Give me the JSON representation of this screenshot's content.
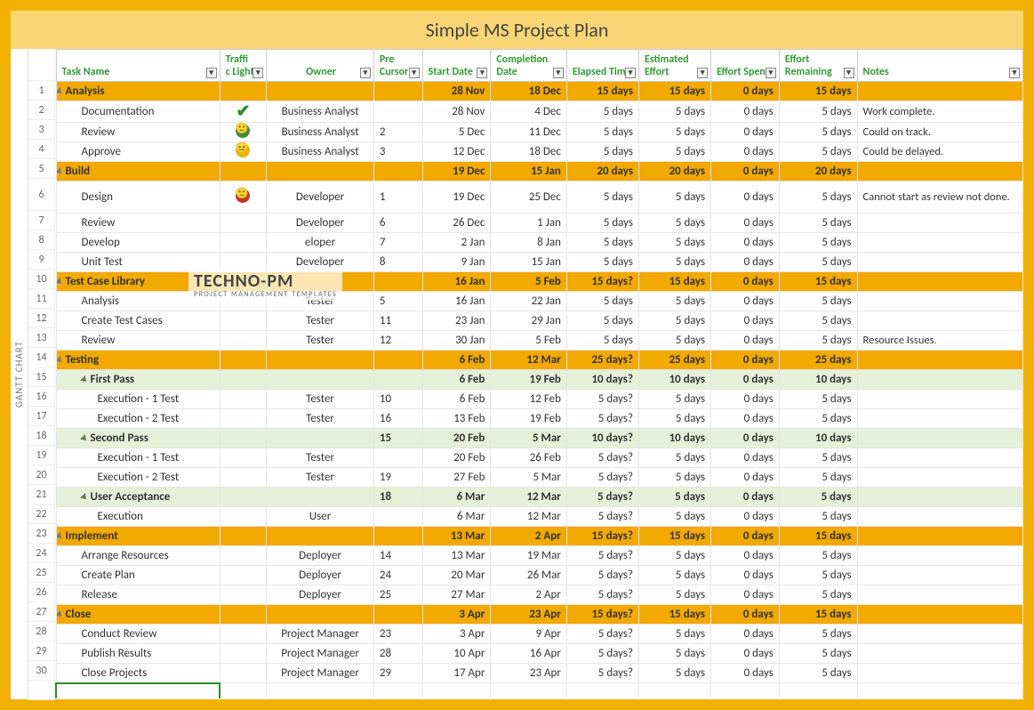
{
  "title": "Simple MS Project Plan",
  "side_label": "GANTT CHART",
  "watermark": {
    "brand": "TECHNO-PM",
    "logo_char": "✔",
    "sub": "PROJECT MANAGEMENT TEMPLATES"
  },
  "headers": {
    "task": "Task Name",
    "traffic": "Traffi\nc Light",
    "owner": "Owner",
    "pre": "Pre Cursor",
    "start": "Start Date",
    "completion": "Completion Date",
    "elapsed": "Elapsed Time",
    "estimated": "Estimated Effort",
    "spent": "Effort Spent",
    "remaining": "Effort Remaining",
    "notes": "Notes"
  },
  "rows": [
    {
      "n": 1,
      "type": "section",
      "indent": 1,
      "task": "Analysis",
      "tl": "",
      "owner": "",
      "pre": "",
      "start": "28 Nov",
      "end": "18 Dec",
      "elapsed": "15 days",
      "est": "15 days",
      "spent": "0 days",
      "rem": "15 days",
      "notes": ""
    },
    {
      "n": 2,
      "type": "task",
      "indent": 2,
      "task": "Documentation",
      "tl": "check",
      "owner": "Business Analyst",
      "pre": "",
      "start": "28 Nov",
      "end": "4 Dec",
      "elapsed": "5 days",
      "est": "5 days",
      "spent": "0 days",
      "rem": "5 days",
      "notes": "Work complete."
    },
    {
      "n": 3,
      "type": "task",
      "indent": 2,
      "task": "Review",
      "tl": "green",
      "owner": "Business Analyst",
      "pre": "2",
      "start": "5 Dec",
      "end": "11 Dec",
      "elapsed": "5 days",
      "est": "5 days",
      "spent": "0 days",
      "rem": "5 days",
      "notes": "Could on track."
    },
    {
      "n": 4,
      "type": "task",
      "indent": 2,
      "task": "Approve",
      "tl": "yellow",
      "owner": "Business Analyst",
      "pre": "3",
      "start": "12 Dec",
      "end": "18 Dec",
      "elapsed": "5 days",
      "est": "5 days",
      "spent": "0 days",
      "rem": "5 days",
      "notes": "Could be delayed."
    },
    {
      "n": 5,
      "type": "section",
      "indent": 1,
      "task": "Build",
      "tl": "",
      "owner": "",
      "pre": "",
      "start": "19 Dec",
      "end": "15 Jan",
      "elapsed": "20 days",
      "est": "20 days",
      "spent": "0 days",
      "rem": "20 days",
      "notes": ""
    },
    {
      "n": 6,
      "type": "task",
      "indent": 2,
      "tall": true,
      "task": "Design",
      "tl": "red",
      "owner": "Developer",
      "pre": "1",
      "start": "19 Dec",
      "end": "25 Dec",
      "elapsed": "5 days",
      "est": "5 days",
      "spent": "0 days",
      "rem": "5 days",
      "notes": "Cannot start as review not done."
    },
    {
      "n": 7,
      "type": "task",
      "indent": 2,
      "task": "Review",
      "tl": "",
      "owner": "Developer",
      "pre": "6",
      "start": "26 Dec",
      "end": "1 Jan",
      "elapsed": "5 days",
      "est": "5 days",
      "spent": "0 days",
      "rem": "5 days",
      "notes": ""
    },
    {
      "n": 8,
      "type": "task",
      "indent": 2,
      "task": "Develop",
      "tl": "",
      "owner": "eloper",
      "pre": "7",
      "start": "2 Jan",
      "end": "8 Jan",
      "elapsed": "5 days",
      "est": "5 days",
      "spent": "0 days",
      "rem": "5 days",
      "notes": ""
    },
    {
      "n": 9,
      "type": "task",
      "indent": 2,
      "task": "Unit Test",
      "tl": "",
      "owner": "Developer",
      "pre": "8",
      "start": "9 Jan",
      "end": "15 Jan",
      "elapsed": "5 days",
      "est": "5 days",
      "spent": "0 days",
      "rem": "5 days",
      "notes": ""
    },
    {
      "n": 10,
      "type": "section",
      "indent": 1,
      "task": "Test Case Library",
      "tl": "",
      "owner": "",
      "pre": "",
      "start": "16 Jan",
      "end": "5 Feb",
      "elapsed": "15 days?",
      "est": "15 days",
      "spent": "0 days",
      "rem": "15 days",
      "notes": ""
    },
    {
      "n": 11,
      "type": "task",
      "indent": 2,
      "task": "Analysis",
      "tl": "",
      "owner": "Tester",
      "pre": "5",
      "start": "16 Jan",
      "end": "22 Jan",
      "elapsed": "5 days",
      "est": "5 days",
      "spent": "0 days",
      "rem": "5 days",
      "notes": ""
    },
    {
      "n": 12,
      "type": "task",
      "indent": 2,
      "task": "Create Test Cases",
      "tl": "",
      "owner": "Tester",
      "pre": "11",
      "start": "23 Jan",
      "end": "29 Jan",
      "elapsed": "5 days",
      "est": "5 days",
      "spent": "0 days",
      "rem": "5 days",
      "notes": ""
    },
    {
      "n": 13,
      "type": "task",
      "indent": 2,
      "task": "Review",
      "tl": "",
      "owner": "Tester",
      "pre": "12",
      "start": "30 Jan",
      "end": "5 Feb",
      "elapsed": "5 days",
      "est": "5 days",
      "spent": "0 days",
      "rem": "5 days",
      "notes": "Resource Issues."
    },
    {
      "n": 14,
      "type": "section",
      "indent": 1,
      "task": "Testing",
      "tl": "",
      "owner": "",
      "pre": "",
      "start": "6 Feb",
      "end": "12 Mar",
      "elapsed": "25 days?",
      "est": "25 days",
      "spent": "0 days",
      "rem": "25 days",
      "notes": ""
    },
    {
      "n": 15,
      "type": "sub",
      "indent": 2,
      "task": "First Pass",
      "tl": "",
      "owner": "",
      "pre": "",
      "start": "6 Feb",
      "end": "19 Feb",
      "elapsed": "10 days?",
      "est": "10 days",
      "spent": "0 days",
      "rem": "10 days",
      "notes": ""
    },
    {
      "n": 16,
      "type": "task",
      "indent": 3,
      "task": "Execution - 1 Test",
      "tl": "",
      "owner": "Tester",
      "pre": "10",
      "start": "6 Feb",
      "end": "12 Feb",
      "elapsed": "5 days?",
      "est": "5 days",
      "spent": "0 days",
      "rem": "5 days",
      "notes": ""
    },
    {
      "n": 17,
      "type": "task",
      "indent": 3,
      "task": "Execution - 2 Test",
      "tl": "",
      "owner": "Tester",
      "pre": "16",
      "start": "13 Feb",
      "end": "19 Feb",
      "elapsed": "5 days?",
      "est": "5 days",
      "spent": "0 days",
      "rem": "5 days",
      "notes": ""
    },
    {
      "n": 18,
      "type": "sub",
      "indent": 2,
      "task": "Second Pass",
      "tl": "",
      "owner": "",
      "pre": "15",
      "start": "20 Feb",
      "end": "5 Mar",
      "elapsed": "10 days?",
      "est": "10 days",
      "spent": "0 days",
      "rem": "10 days",
      "notes": ""
    },
    {
      "n": 19,
      "type": "task",
      "indent": 3,
      "task": "Execution - 1 Test",
      "tl": "",
      "owner": "Tester",
      "pre": "",
      "start": "20 Feb",
      "end": "26 Feb",
      "elapsed": "5 days?",
      "est": "5 days",
      "spent": "0 days",
      "rem": "5 days",
      "notes": ""
    },
    {
      "n": 20,
      "type": "task",
      "indent": 3,
      "task": "Execution - 2 Test",
      "tl": "",
      "owner": "Tester",
      "pre": "19",
      "start": "27 Feb",
      "end": "5 Mar",
      "elapsed": "5 days?",
      "est": "5 days",
      "spent": "0 days",
      "rem": "5 days",
      "notes": ""
    },
    {
      "n": 21,
      "type": "sub",
      "indent": 2,
      "task": "User Acceptance",
      "tl": "",
      "owner": "",
      "pre": "18",
      "start": "6 Mar",
      "end": "12 Mar",
      "elapsed": "5 days?",
      "est": "5 days",
      "spent": "0 days",
      "rem": "5 days",
      "notes": ""
    },
    {
      "n": 22,
      "type": "task",
      "indent": 3,
      "task": "Execution",
      "tl": "",
      "owner": "User",
      "pre": "",
      "start": "6 Mar",
      "end": "12 Mar",
      "elapsed": "5 days?",
      "est": "5 days",
      "spent": "0 days",
      "rem": "5 days",
      "notes": ""
    },
    {
      "n": 23,
      "type": "section",
      "indent": 1,
      "task": "Implement",
      "tl": "",
      "owner": "",
      "pre": "",
      "start": "13 Mar",
      "end": "2 Apr",
      "elapsed": "15 days?",
      "est": "15 days",
      "spent": "0 days",
      "rem": "15 days",
      "notes": ""
    },
    {
      "n": 24,
      "type": "task",
      "indent": 2,
      "task": "Arrange Resources",
      "tl": "",
      "owner": "Deployer",
      "pre": "14",
      "start": "13 Mar",
      "end": "19 Mar",
      "elapsed": "5 days?",
      "est": "5 days",
      "spent": "0 days",
      "rem": "5 days",
      "notes": ""
    },
    {
      "n": 25,
      "type": "task",
      "indent": 2,
      "task": "Create Plan",
      "tl": "",
      "owner": "Deployer",
      "pre": "24",
      "start": "20 Mar",
      "end": "26 Mar",
      "elapsed": "5 days?",
      "est": "5 days",
      "spent": "0 days",
      "rem": "5 days",
      "notes": ""
    },
    {
      "n": 26,
      "type": "task",
      "indent": 2,
      "task": "Release",
      "tl": "",
      "owner": "Deployer",
      "pre": "25",
      "start": "27 Mar",
      "end": "2 Apr",
      "elapsed": "5 days?",
      "est": "5 days",
      "spent": "0 days",
      "rem": "5 days",
      "notes": ""
    },
    {
      "n": 27,
      "type": "section",
      "indent": 1,
      "task": "Close",
      "tl": "",
      "owner": "",
      "pre": "",
      "start": "3 Apr",
      "end": "23 Apr",
      "elapsed": "15 days?",
      "est": "15 days",
      "spent": "0 days",
      "rem": "15 days",
      "notes": ""
    },
    {
      "n": 28,
      "type": "task",
      "indent": 2,
      "task": "Conduct Review",
      "tl": "",
      "owner": "Project Manager",
      "pre": "23",
      "start": "3 Apr",
      "end": "9 Apr",
      "elapsed": "5 days?",
      "est": "5 days",
      "spent": "0 days",
      "rem": "5 days",
      "notes": ""
    },
    {
      "n": 29,
      "type": "task",
      "indent": 2,
      "task": "Publish Results",
      "tl": "",
      "owner": "Project Manager",
      "pre": "28",
      "start": "10 Apr",
      "end": "16 Apr",
      "elapsed": "5 days?",
      "est": "5 days",
      "spent": "0 days",
      "rem": "5 days",
      "notes": ""
    },
    {
      "n": 30,
      "type": "task",
      "indent": 2,
      "task": "Close Projects",
      "tl": "",
      "owner": "Project Manager",
      "pre": "29",
      "start": "17 Apr",
      "end": "23 Apr",
      "elapsed": "5 days?",
      "est": "5 days",
      "spent": "0 days",
      "rem": "5 days",
      "notes": ""
    }
  ]
}
